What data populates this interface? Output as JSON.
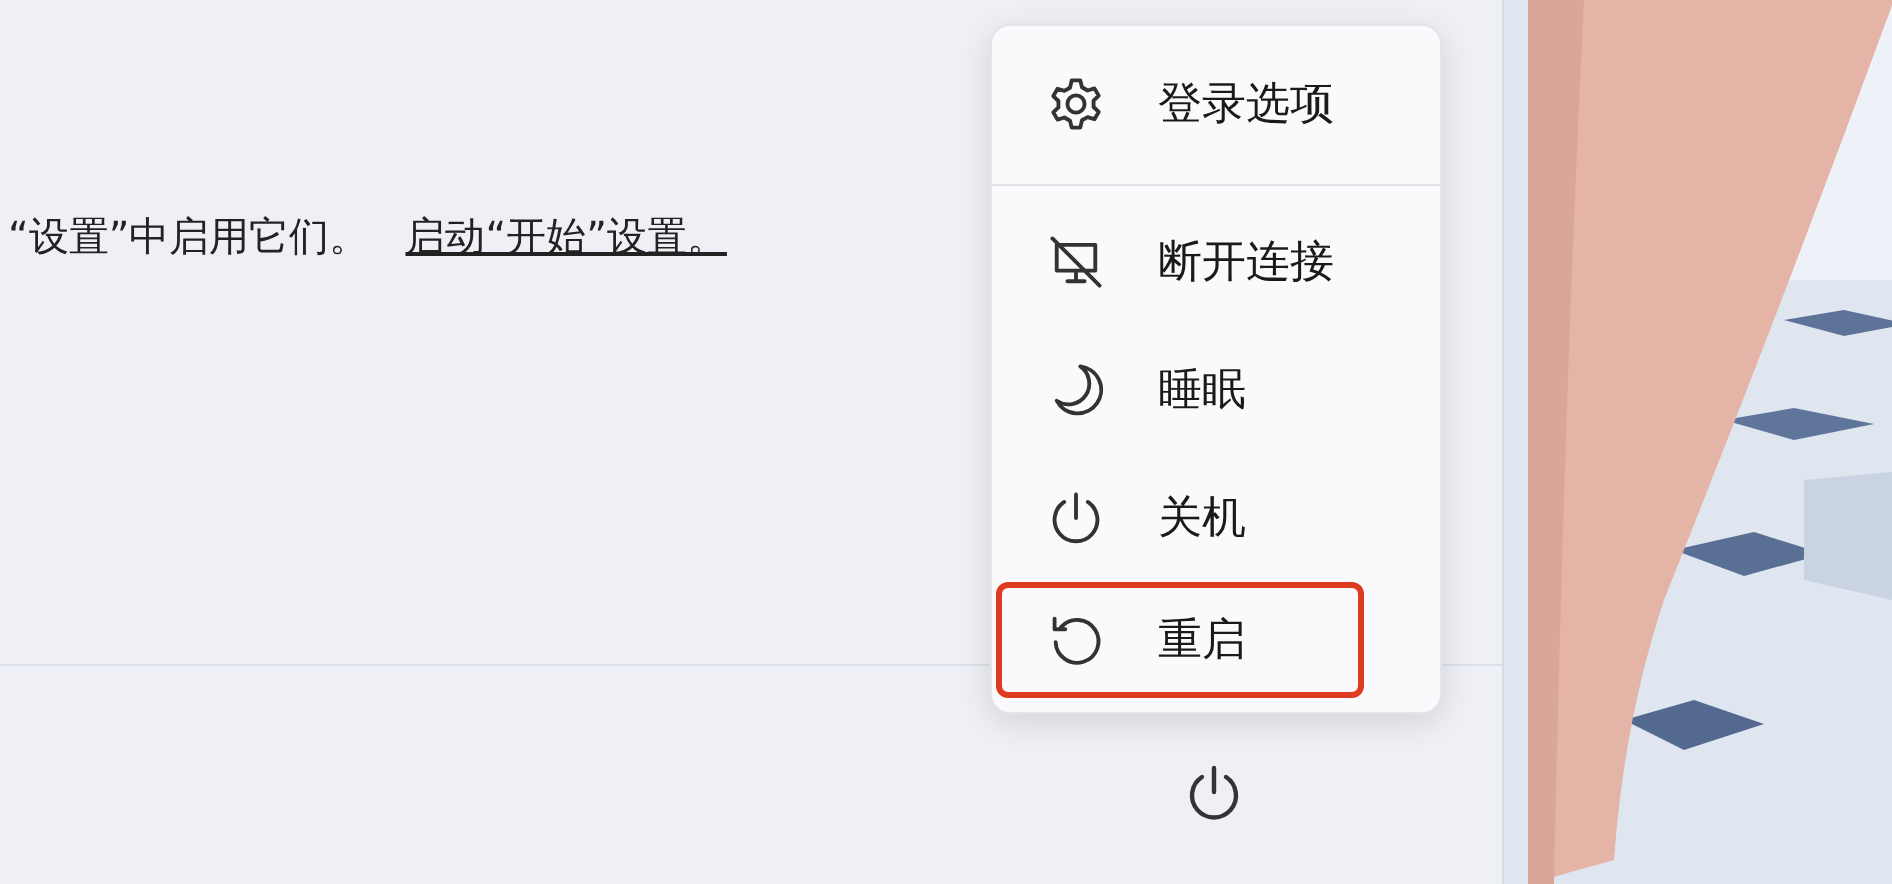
{
  "start_menu": {
    "notice": "“设置”中启用它们。",
    "settings_link": "启动“开始”设置。"
  },
  "power_menu": {
    "groups": [
      [
        {
          "kind": "gear",
          "label": "登录选项",
          "highlighted": false
        }
      ],
      [
        {
          "kind": "disconnect",
          "label": "断开连接",
          "highlighted": false
        },
        {
          "kind": "sleep",
          "label": "睡眠",
          "highlighted": false
        },
        {
          "kind": "power",
          "label": "关机",
          "highlighted": false
        },
        {
          "kind": "restart",
          "label": "重启",
          "highlighted": true
        }
      ]
    ]
  }
}
